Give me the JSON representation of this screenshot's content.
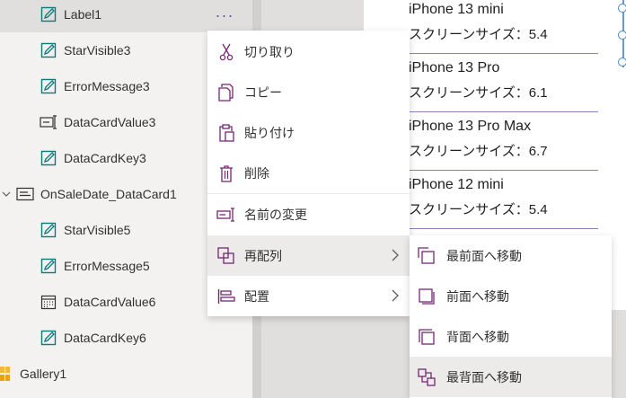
{
  "tree": {
    "items": [
      {
        "label": "Label1",
        "icon": "edit-icon"
      },
      {
        "label": "StarVisible3",
        "icon": "edit-icon"
      },
      {
        "label": "ErrorMessage3",
        "icon": "edit-icon"
      },
      {
        "label": "DataCardValue3",
        "icon": "text-input-icon"
      },
      {
        "label": "DataCardKey3",
        "icon": "edit-icon"
      },
      {
        "label": "OnSaleDate_DataCard1",
        "icon": "card-icon"
      },
      {
        "label": "StarVisible5",
        "icon": "edit-icon"
      },
      {
        "label": "ErrorMessage5",
        "icon": "edit-icon"
      },
      {
        "label": "DataCardValue6",
        "icon": "calendar-icon"
      },
      {
        "label": "DataCardKey6",
        "icon": "edit-icon"
      },
      {
        "label": "Gallery1",
        "icon": "gallery-icon"
      }
    ],
    "more_label": "···"
  },
  "gallery": {
    "items": [
      {
        "title": "iPhone 13 mini",
        "subtitle": "スクリーンサイズ：5.4"
      },
      {
        "title": "iPhone 13 Pro",
        "subtitle": "スクリーンサイズ：6.1"
      },
      {
        "title": "iPhone 13 Pro Max",
        "subtitle": "スクリーンサイズ：6.7"
      },
      {
        "title": "iPhone 12 mini",
        "subtitle": "スクリーンサイズ：5.4"
      }
    ]
  },
  "context_menu": {
    "items": [
      {
        "label": "切り取り",
        "icon": "scissors-icon"
      },
      {
        "label": "コピー",
        "icon": "copy-icon"
      },
      {
        "label": "貼り付け",
        "icon": "paste-icon"
      },
      {
        "label": "削除",
        "icon": "trash-icon"
      },
      {
        "label": "名前の変更",
        "icon": "rename-icon"
      },
      {
        "label": "再配列",
        "icon": "reorder-icon"
      },
      {
        "label": "配置",
        "icon": "align-icon"
      }
    ]
  },
  "submenu": {
    "items": [
      {
        "label": "最前面へ移動",
        "icon": "bring-to-front-icon"
      },
      {
        "label": "前面へ移動",
        "icon": "bring-forward-icon"
      },
      {
        "label": "背面へ移動",
        "icon": "send-backward-icon"
      },
      {
        "label": "最背面へ移動",
        "icon": "send-to-back-icon"
      }
    ]
  },
  "colors": {
    "accent": "#742774",
    "selection": "#e1dfdd",
    "menu_hover": "#edebe9"
  }
}
